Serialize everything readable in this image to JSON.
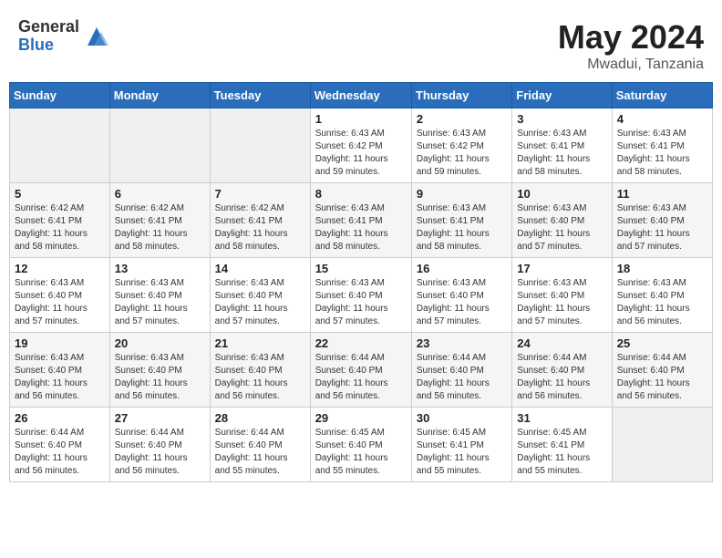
{
  "header": {
    "logo_general": "General",
    "logo_blue": "Blue",
    "month_year": "May 2024",
    "location": "Mwadui, Tanzania"
  },
  "weekdays": [
    "Sunday",
    "Monday",
    "Tuesday",
    "Wednesday",
    "Thursday",
    "Friday",
    "Saturday"
  ],
  "weeks": [
    [
      {
        "day": "",
        "info": ""
      },
      {
        "day": "",
        "info": ""
      },
      {
        "day": "",
        "info": ""
      },
      {
        "day": "1",
        "info": "Sunrise: 6:43 AM\nSunset: 6:42 PM\nDaylight: 11 hours\nand 59 minutes."
      },
      {
        "day": "2",
        "info": "Sunrise: 6:43 AM\nSunset: 6:42 PM\nDaylight: 11 hours\nand 59 minutes."
      },
      {
        "day": "3",
        "info": "Sunrise: 6:43 AM\nSunset: 6:41 PM\nDaylight: 11 hours\nand 58 minutes."
      },
      {
        "day": "4",
        "info": "Sunrise: 6:43 AM\nSunset: 6:41 PM\nDaylight: 11 hours\nand 58 minutes."
      }
    ],
    [
      {
        "day": "5",
        "info": "Sunrise: 6:42 AM\nSunset: 6:41 PM\nDaylight: 11 hours\nand 58 minutes."
      },
      {
        "day": "6",
        "info": "Sunrise: 6:42 AM\nSunset: 6:41 PM\nDaylight: 11 hours\nand 58 minutes."
      },
      {
        "day": "7",
        "info": "Sunrise: 6:42 AM\nSunset: 6:41 PM\nDaylight: 11 hours\nand 58 minutes."
      },
      {
        "day": "8",
        "info": "Sunrise: 6:43 AM\nSunset: 6:41 PM\nDaylight: 11 hours\nand 58 minutes."
      },
      {
        "day": "9",
        "info": "Sunrise: 6:43 AM\nSunset: 6:41 PM\nDaylight: 11 hours\nand 58 minutes."
      },
      {
        "day": "10",
        "info": "Sunrise: 6:43 AM\nSunset: 6:40 PM\nDaylight: 11 hours\nand 57 minutes."
      },
      {
        "day": "11",
        "info": "Sunrise: 6:43 AM\nSunset: 6:40 PM\nDaylight: 11 hours\nand 57 minutes."
      }
    ],
    [
      {
        "day": "12",
        "info": "Sunrise: 6:43 AM\nSunset: 6:40 PM\nDaylight: 11 hours\nand 57 minutes."
      },
      {
        "day": "13",
        "info": "Sunrise: 6:43 AM\nSunset: 6:40 PM\nDaylight: 11 hours\nand 57 minutes."
      },
      {
        "day": "14",
        "info": "Sunrise: 6:43 AM\nSunset: 6:40 PM\nDaylight: 11 hours\nand 57 minutes."
      },
      {
        "day": "15",
        "info": "Sunrise: 6:43 AM\nSunset: 6:40 PM\nDaylight: 11 hours\nand 57 minutes."
      },
      {
        "day": "16",
        "info": "Sunrise: 6:43 AM\nSunset: 6:40 PM\nDaylight: 11 hours\nand 57 minutes."
      },
      {
        "day": "17",
        "info": "Sunrise: 6:43 AM\nSunset: 6:40 PM\nDaylight: 11 hours\nand 57 minutes."
      },
      {
        "day": "18",
        "info": "Sunrise: 6:43 AM\nSunset: 6:40 PM\nDaylight: 11 hours\nand 56 minutes."
      }
    ],
    [
      {
        "day": "19",
        "info": "Sunrise: 6:43 AM\nSunset: 6:40 PM\nDaylight: 11 hours\nand 56 minutes."
      },
      {
        "day": "20",
        "info": "Sunrise: 6:43 AM\nSunset: 6:40 PM\nDaylight: 11 hours\nand 56 minutes."
      },
      {
        "day": "21",
        "info": "Sunrise: 6:43 AM\nSunset: 6:40 PM\nDaylight: 11 hours\nand 56 minutes."
      },
      {
        "day": "22",
        "info": "Sunrise: 6:44 AM\nSunset: 6:40 PM\nDaylight: 11 hours\nand 56 minutes."
      },
      {
        "day": "23",
        "info": "Sunrise: 6:44 AM\nSunset: 6:40 PM\nDaylight: 11 hours\nand 56 minutes."
      },
      {
        "day": "24",
        "info": "Sunrise: 6:44 AM\nSunset: 6:40 PM\nDaylight: 11 hours\nand 56 minutes."
      },
      {
        "day": "25",
        "info": "Sunrise: 6:44 AM\nSunset: 6:40 PM\nDaylight: 11 hours\nand 56 minutes."
      }
    ],
    [
      {
        "day": "26",
        "info": "Sunrise: 6:44 AM\nSunset: 6:40 PM\nDaylight: 11 hours\nand 56 minutes."
      },
      {
        "day": "27",
        "info": "Sunrise: 6:44 AM\nSunset: 6:40 PM\nDaylight: 11 hours\nand 56 minutes."
      },
      {
        "day": "28",
        "info": "Sunrise: 6:44 AM\nSunset: 6:40 PM\nDaylight: 11 hours\nand 55 minutes."
      },
      {
        "day": "29",
        "info": "Sunrise: 6:45 AM\nSunset: 6:40 PM\nDaylight: 11 hours\nand 55 minutes."
      },
      {
        "day": "30",
        "info": "Sunrise: 6:45 AM\nSunset: 6:41 PM\nDaylight: 11 hours\nand 55 minutes."
      },
      {
        "day": "31",
        "info": "Sunrise: 6:45 AM\nSunset: 6:41 PM\nDaylight: 11 hours\nand 55 minutes."
      },
      {
        "day": "",
        "info": ""
      }
    ]
  ]
}
